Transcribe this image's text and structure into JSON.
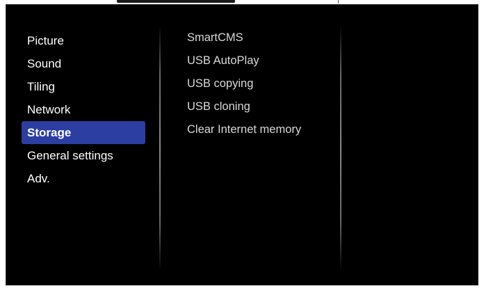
{
  "menu": {
    "items": [
      {
        "label": "Picture"
      },
      {
        "label": "Sound"
      },
      {
        "label": "Tiling"
      },
      {
        "label": "Network"
      },
      {
        "label": "Storage",
        "selected": true
      },
      {
        "label": "General settings"
      },
      {
        "label": "Adv."
      }
    ]
  },
  "submenu": {
    "items": [
      {
        "label": "SmartCMS"
      },
      {
        "label": "USB AutoPlay"
      },
      {
        "label": "USB copying"
      },
      {
        "label": "USB cloning"
      },
      {
        "label": "Clear Internet memory"
      }
    ]
  },
  "colors": {
    "background": "#000000",
    "selected_highlight": "#2c3ea1",
    "text_primary": "#ffffff",
    "text_secondary": "#d8d8d8",
    "divider": "#8a8a8a"
  }
}
